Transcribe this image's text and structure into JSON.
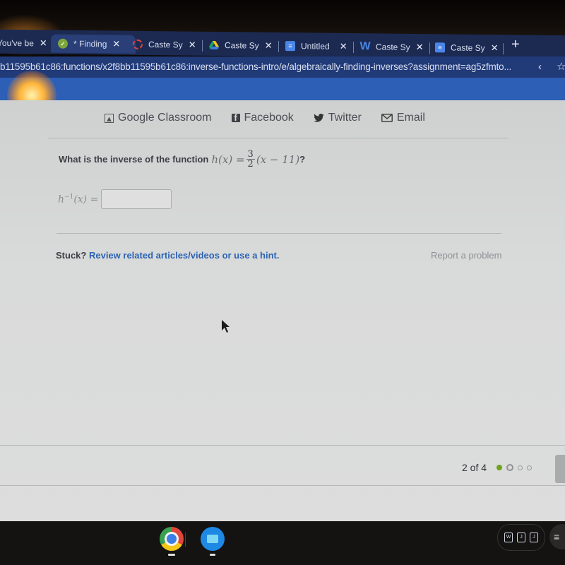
{
  "browser": {
    "tabs": [
      {
        "title": "You've be",
        "icon": "generic-icon",
        "active": false
      },
      {
        "title": "* Finding",
        "icon": "khan-academy-icon",
        "active": true
      },
      {
        "title": "Caste Sy",
        "icon": "loading-icon",
        "active": false
      },
      {
        "title": "Caste Sy",
        "icon": "google-drive-icon",
        "active": false
      },
      {
        "title": "Untitled",
        "icon": "google-docs-icon",
        "active": false
      },
      {
        "title": "Caste Sy",
        "icon": "word-icon",
        "active": false
      },
      {
        "title": "Caste Sy",
        "icon": "google-docs-icon",
        "active": false
      }
    ],
    "new_tab_label": "+",
    "close_label": "✕",
    "url": "b11595b61c86:functions/x2f8bb11595b61c86:inverse-functions-intro/e/algebraically-finding-inverses?assignment=ag5zfmto...",
    "share_icon": "‹",
    "star_icon": "☆"
  },
  "share": {
    "items": [
      {
        "label": "Google Classroom",
        "icon": "google-classroom-icon"
      },
      {
        "label": "Facebook",
        "icon": "facebook-icon"
      },
      {
        "label": "Twitter",
        "icon": "twitter-icon"
      },
      {
        "label": "Email",
        "icon": "email-icon"
      }
    ]
  },
  "exercise": {
    "question_text": "What is the inverse of the function",
    "func_lhs": "h(x) =",
    "frac_num": "3",
    "frac_den": "2",
    "func_rhs": "(x − 11)",
    "question_end": "?",
    "answer_label_base": "h",
    "answer_label_sup": "−1",
    "answer_label_rest": "(x) =",
    "answer_value": "",
    "answer_placeholder": ""
  },
  "help": {
    "stuck_label": "Stuck?",
    "hint_link": "Review related articles/videos or use a hint.",
    "report_label": "Report a problem"
  },
  "progress": {
    "label": "2 of 4",
    "current": 2,
    "total": 4,
    "completed": 1
  },
  "shelf": {
    "apps": [
      {
        "name": "Chrome",
        "icon": "chrome-icon"
      },
      {
        "name": "Files",
        "icon": "files-icon"
      }
    ],
    "tray_keys": [
      "W",
      "J",
      "J"
    ],
    "status_icon": "≡"
  },
  "colors": {
    "tabstrip": "#1c2a52",
    "urlbar": "#213a78",
    "header_blue": "#2c5fb5",
    "link_blue": "#2b63b3",
    "progress_green": "#6ea31c"
  }
}
